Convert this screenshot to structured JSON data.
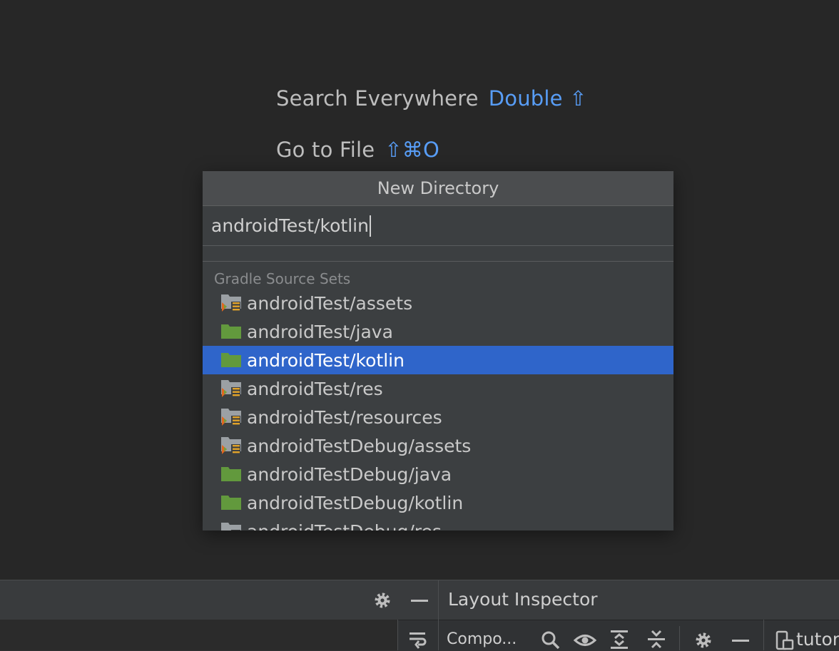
{
  "hints": {
    "search_everywhere": {
      "label": "Search Everywhere",
      "shortcut": "Double ⇧"
    },
    "go_to_file": {
      "label": "Go to File",
      "shortcut": "⇧⌘O"
    }
  },
  "popup": {
    "title": "New Directory",
    "input_value": "androidTest/kotlin",
    "group_label": "Gradle Source Sets",
    "items": [
      {
        "label": "androidTest/assets",
        "icon": "resource-folder-icon"
      },
      {
        "label": "androidTest/java",
        "icon": "source-folder-icon"
      },
      {
        "label": "androidTest/kotlin",
        "icon": "source-folder-icon",
        "selected": true
      },
      {
        "label": "androidTest/res",
        "icon": "resource-folder-icon"
      },
      {
        "label": "androidTest/resources",
        "icon": "resource-folder-icon"
      },
      {
        "label": "androidTestDebug/assets",
        "icon": "resource-folder-icon"
      },
      {
        "label": "androidTestDebug/java",
        "icon": "source-folder-icon"
      },
      {
        "label": "androidTestDebug/kotlin",
        "icon": "source-folder-icon"
      },
      {
        "label": "androidTestDebug/res",
        "icon": "resource-folder-icon"
      }
    ]
  },
  "bottom_panel": {
    "title": "Layout Inspector",
    "component_tab": "Compo...",
    "device_label": "tutor"
  },
  "colors": {
    "background": "#272727",
    "accent": "#589df6",
    "selection": "#2f65ca",
    "folder_green": "#62993d"
  }
}
